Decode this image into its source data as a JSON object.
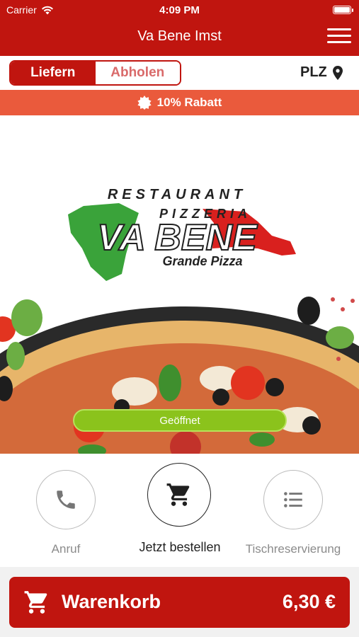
{
  "status_bar": {
    "carrier": "Carrier",
    "time": "4:09 PM"
  },
  "header": {
    "title": "Va Bene Imst"
  },
  "order_mode": {
    "options": [
      "Liefern",
      "Abholen"
    ],
    "selected": "Liefern"
  },
  "location": {
    "label": "PLZ"
  },
  "discount": {
    "text": "10% Rabatt"
  },
  "logo": {
    "line1": "RESTAURANT",
    "line2": "PIZZERIA",
    "brand": "VA BENE",
    "tagline": "Grande Pizza"
  },
  "hero": {
    "status": "Geöffnet"
  },
  "actions": [
    {
      "label": "Anruf",
      "icon": "phone-icon"
    },
    {
      "label": "Jetzt bestellen",
      "icon": "cart-icon"
    },
    {
      "label": "Tischreservierung",
      "icon": "list-icon"
    }
  ],
  "cart": {
    "label": "Warenkorb",
    "total": "6,30 €"
  },
  "colors": {
    "brand_red": "#c0150f",
    "discount_orange": "#ea5a3c",
    "open_green": "#8bc31c"
  }
}
